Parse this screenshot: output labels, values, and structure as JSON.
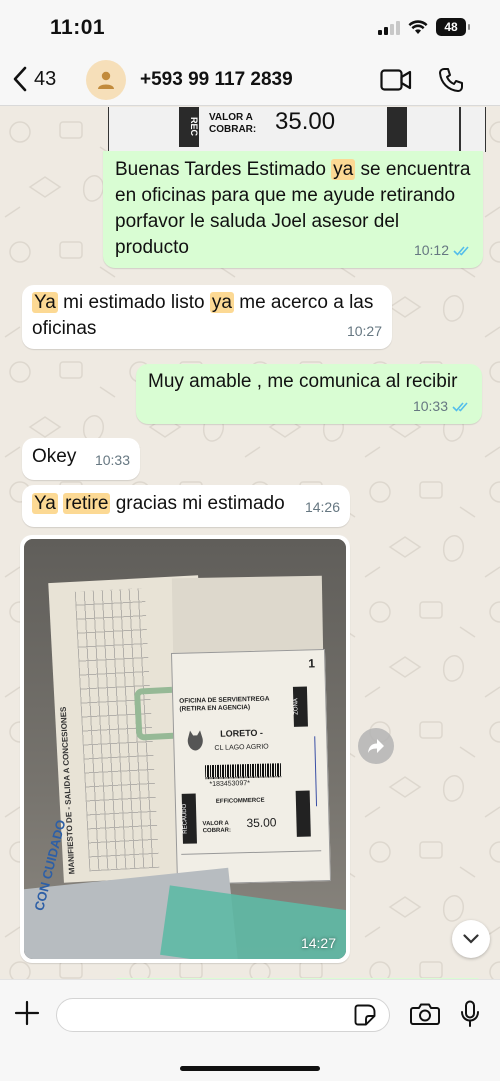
{
  "status_bar": {
    "time": "11:01",
    "battery": "48"
  },
  "header": {
    "back_count": "43",
    "contact_name": "+593 99 117 2839"
  },
  "receipt_fragment": {
    "label": "VALOR A\nCOBRAR:",
    "amount": "35.00"
  },
  "messages": [
    {
      "direction": "outgoing",
      "text_parts": [
        "Buenas Tardes Estimado ",
        "ya",
        " se encuentra en oficinas para que me ayude retirando porfavor le saluda Joel asesor del producto"
      ],
      "time": "10:12",
      "read": true
    },
    {
      "direction": "incoming",
      "text_parts": [
        "Ya",
        " mi estimado listo ",
        "ya",
        " me acerco a las oficinas"
      ],
      "time": "10:27"
    },
    {
      "direction": "outgoing",
      "text": "Muy amable , me comunica al recibir",
      "time": "10:33",
      "read": true
    },
    {
      "direction": "incoming",
      "text": "Okey",
      "time": "10:33"
    },
    {
      "direction": "incoming",
      "text_parts": [
        "Ya",
        " ",
        "retire",
        " gracias mi estimado"
      ],
      "time": "14:26"
    }
  ],
  "photo_message": {
    "time": "14:27",
    "receipt": {
      "title": "MANIFIESTO DE - SALIDA A CONCESIONES",
      "office": "OFICINA DE SERVIENTREGA (RETIRA EN AGENCIA)",
      "city": "LORETO -",
      "destination": "CL LAGO AGRIO",
      "tracking": "*183453097*",
      "sender": "EFFICOMMERCE",
      "value_label": "VALOR A COBRAR:",
      "amount": "35.00",
      "zone_label": "ZONA",
      "zone": "1",
      "recaudo": "RECAUDO",
      "box_text": "CON CUIDADO"
    }
  },
  "input": {
    "placeholder": ""
  },
  "colors": {
    "outgoing_bubble": "#d9fdd3",
    "incoming_bubble": "#ffffff",
    "highlight": "#fcd994",
    "read_ticks": "#53bdeb",
    "background": "#efeae2"
  }
}
